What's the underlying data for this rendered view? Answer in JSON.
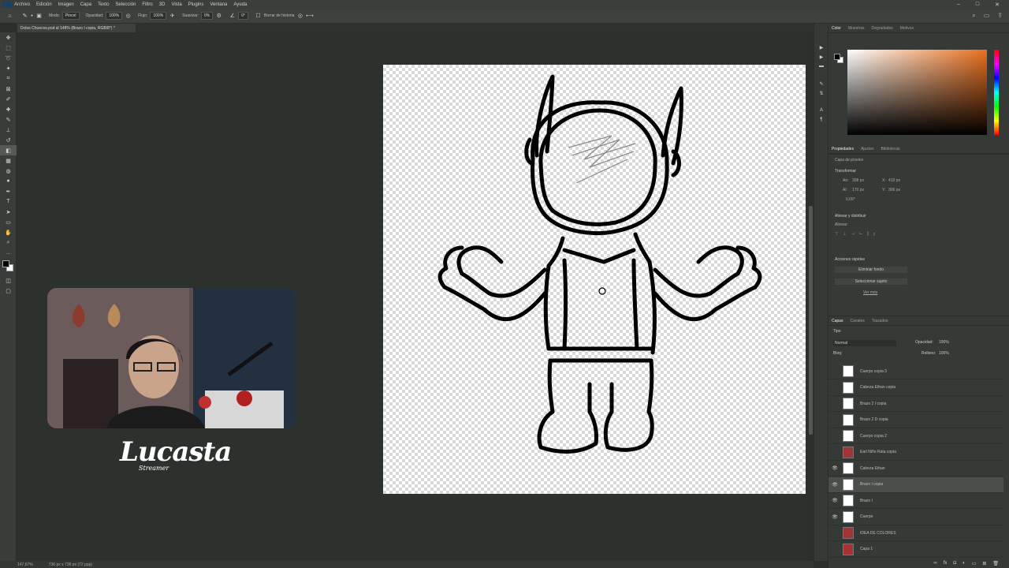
{
  "menu": [
    "Archivo",
    "Edición",
    "Imagen",
    "Capa",
    "Texto",
    "Selección",
    "Filtro",
    "3D",
    "Vista",
    "Plugins",
    "Ventana",
    "Ayuda"
  ],
  "options": {
    "modo_label": "Modo:",
    "modo_value": "Pincel",
    "opacidad_label": "Opacidad:",
    "opacidad_value": "100%",
    "flujo_label": "Flujo:",
    "flujo_value": "100%",
    "suavizar_label": "Suavizar:",
    "suavizar_value": "0%",
    "angle_value": "0°",
    "borrar_label": "Borrar de historia"
  },
  "doc_tab": "Dctos Chuecos.psd al 148% (Brazo I copia, RGB/8*) *",
  "status": {
    "zoom": "147,67%",
    "size": "736 px x 736 px (72 ppp)"
  },
  "streamer": {
    "name": "Lucasta",
    "sub": "Streamer"
  },
  "panels": {
    "color_tabs": [
      "Color",
      "Muestras",
      "Degradados",
      "Motivos"
    ],
    "props_tabs": [
      "Propiedades",
      "Ajustes",
      "Bibliotecas"
    ],
    "props_title": "Capa de píxeles",
    "transformar": "Transformar",
    "an": "An:",
    "an_value": "308 px",
    "al": "Al:",
    "al_value": "170 px",
    "x": "X:",
    "x_value": "410 px",
    "y": "Y:",
    "y_value": "306 px",
    "angle": "0,00°",
    "alinear": "Alinear y distribuir",
    "alinear_sub": "Alinear:",
    "acciones": "Acciones rápidas",
    "eliminar_fondo": "Eliminar fondo",
    "seleccionar_sujeto": "Seleccionar sujeto",
    "ver_mas": "Ver más"
  },
  "layers": {
    "tabs": [
      "Capas",
      "Canales",
      "Trazados"
    ],
    "kind": "Tipo",
    "blend": "Normal",
    "opacity_label": "Opacidad:",
    "opacity_value": "100%",
    "lock_label": "Bloq:",
    "fill_label": "Relleno:",
    "fill_value": "100%",
    "items": [
      {
        "name": "Cuerpo copia 3",
        "visible": false,
        "red": false,
        "selected": false
      },
      {
        "name": "Cabeza Ethan copia",
        "visible": false,
        "red": false,
        "selected": false
      },
      {
        "name": "Brazo 2 I copia",
        "visible": false,
        "red": false,
        "selected": false
      },
      {
        "name": "Brazo 2 D copia",
        "visible": false,
        "red": false,
        "selected": false
      },
      {
        "name": "Cuerpo copia 2",
        "visible": false,
        "red": false,
        "selected": false
      },
      {
        "name": "Earl Niño Rata copia",
        "visible": false,
        "red": true,
        "selected": false
      },
      {
        "name": "Cabeza Ethan",
        "visible": true,
        "red": false,
        "selected": false
      },
      {
        "name": "Brazo I copia",
        "visible": true,
        "red": false,
        "selected": true
      },
      {
        "name": "Brazo I",
        "visible": true,
        "red": false,
        "selected": false
      },
      {
        "name": "Cuerpo",
        "visible": true,
        "red": false,
        "selected": false
      },
      {
        "name": "IDEA DE COLORES",
        "visible": false,
        "red": true,
        "selected": false
      },
      {
        "name": "Capa 1",
        "visible": false,
        "red": true,
        "selected": false
      }
    ]
  }
}
